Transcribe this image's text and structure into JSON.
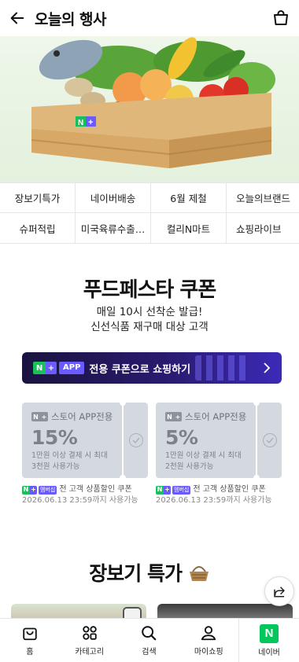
{
  "header": {
    "title": "오늘의 행사"
  },
  "banner": {
    "badge": "N+"
  },
  "categories": [
    "장보기특가",
    "네이버배송",
    "6월 제철",
    "오늘의브랜드",
    "슈퍼적립",
    "미국육류수출…",
    "컬리N마트",
    "쇼핑라이브"
  ],
  "coupon_section": {
    "title": "푸드페스타 쿠폰",
    "subtitle_line1": "매일 10시 선착순 발급!",
    "subtitle_line2": "신선식품 재구매 대상 고객",
    "app_banner": {
      "badge_n": "N",
      "badge_plus": "+",
      "app_tag": "APP",
      "text": "전용 쿠폰으로 쇼핑하기"
    },
    "coupons": [
      {
        "label": "스토어 APP전용",
        "percent": "15%",
        "cond1": "1만원 이상 결제 시 최대",
        "cond2": "3천원 사용가능",
        "note_tag": "멤버십",
        "note_text": "전 고객 상품할인 쿠폰",
        "note_date": "2026.06.13 23:59까지 사용가능"
      },
      {
        "label": "스토어 APP전용",
        "percent": "5%",
        "cond1": "1만원 이상 결제 시 최대",
        "cond2": "2천원 사용가능",
        "note_tag": "멤버십",
        "note_text": "전 고객 상품할인 쿠폰",
        "note_date": "2026.06.13 23:59까지 사용가능"
      }
    ]
  },
  "grocery": {
    "title": "장보기 특가"
  },
  "tabbar": [
    {
      "label": "홈",
      "icon": "bag-icon"
    },
    {
      "label": "카테고리",
      "icon": "grid-icon"
    },
    {
      "label": "검색",
      "icon": "search-icon"
    },
    {
      "label": "마이쇼핑",
      "icon": "person-icon"
    },
    {
      "label": "네이버",
      "icon": "naver-icon"
    }
  ],
  "colors": {
    "naver_green": "#03c75a",
    "plus_purple": "#6a5bff",
    "app_banner_dark": "#1a1340"
  }
}
